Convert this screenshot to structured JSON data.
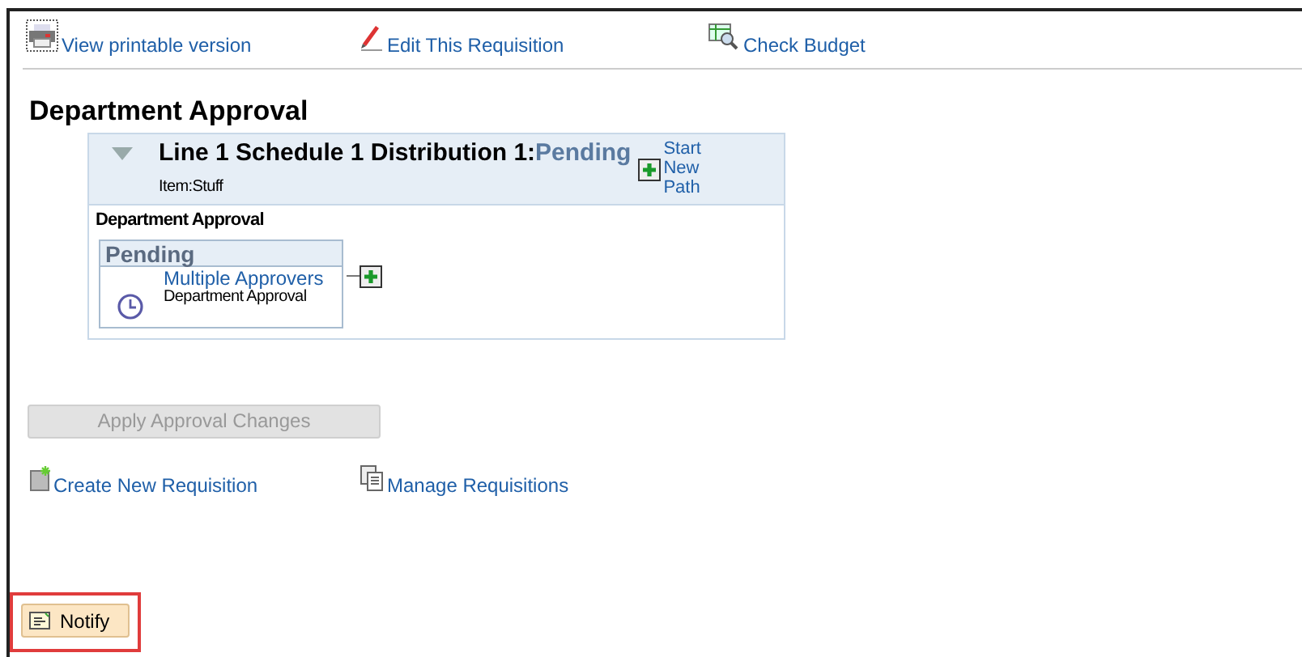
{
  "top_links": [
    {
      "kind": "printer",
      "label": "View printable version"
    },
    {
      "kind": "pencil",
      "label": "Edit This Requisition"
    },
    {
      "kind": "budget",
      "label": "Check Budget"
    }
  ],
  "section": {
    "title": "Department Approval",
    "line": {
      "expanded": true,
      "title": "Line 1 Schedule 1 Distribution 1:",
      "status": "Pending",
      "item": "Item:Stuff",
      "start_path": "Start New Path",
      "stage": "Department Approval",
      "step": {
        "status": "Pending",
        "approver": "Multiple Approvers",
        "role": "Department Approval"
      }
    }
  },
  "apply_button": {
    "label": "Apply Approval Changes",
    "disabled": true
  },
  "bottom_links": [
    {
      "kind": "new",
      "label": "Create New Requisition"
    },
    {
      "kind": "manage",
      "label": "Manage Requisitions"
    }
  ],
  "notify_button": {
    "label": "Notify",
    "highlighted": true
  }
}
